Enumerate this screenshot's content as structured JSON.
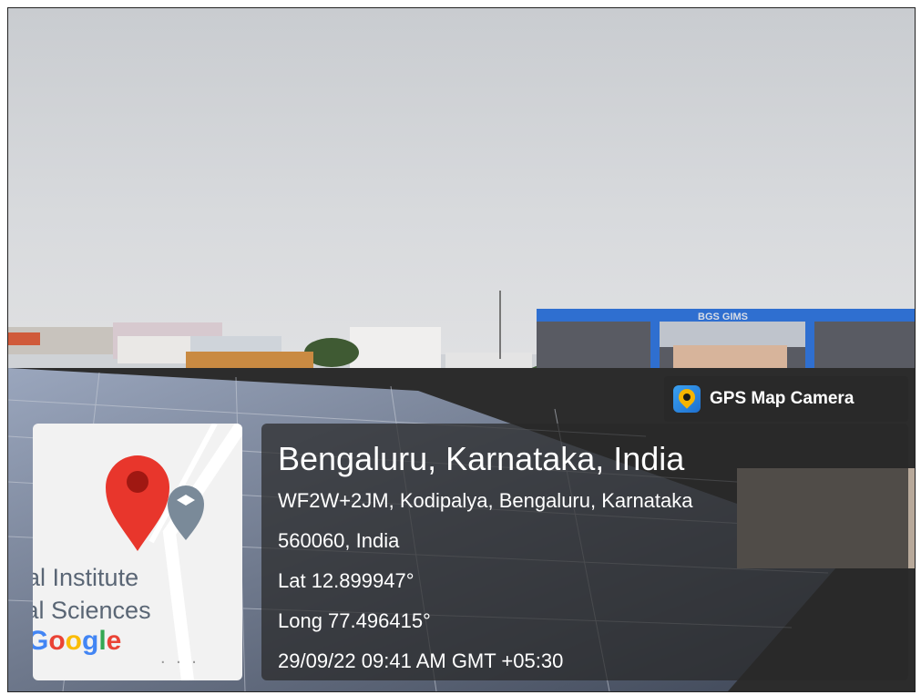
{
  "badge": {
    "label": "GPS Map Camera",
    "icon": "map-pin-app-icon"
  },
  "map": {
    "label_line1": "bal Institute",
    "label_line2": "cal Sciences",
    "google_letters": [
      "G",
      "o",
      "o",
      "g",
      "l",
      "e"
    ],
    "ellipsis": ". . .",
    "pin_color": "#e8362c",
    "school_pin_color": "#7a8a99"
  },
  "info": {
    "title": "Bengaluru, Karnataka, India",
    "address_line1": "WF2W+2JM, Kodipalya, Bengaluru, Karnataka",
    "address_line2": "560060, India",
    "latitude": "Lat 12.899947°",
    "longitude": "Long 77.496415°",
    "datetime": "29/09/22 09:41 AM GMT +05:30"
  },
  "building_sign": "BGS GIMS"
}
